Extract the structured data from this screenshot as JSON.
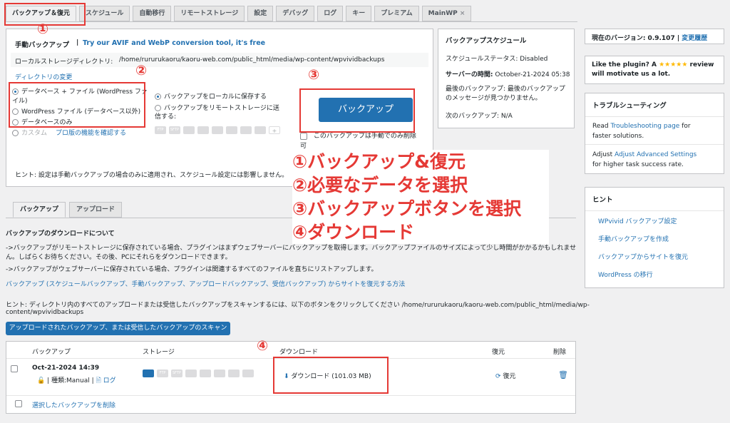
{
  "tabs": [
    "バックアップ＆復元",
    "スケジュール",
    "自動移行",
    "リモートストレージ",
    "設定",
    "デバッグ",
    "ログ",
    "キー",
    "プレミアム",
    "MainWP"
  ],
  "tab_close": "×",
  "manual": {
    "title": "手動バックアップ",
    "avif_link": "Try our AVIF and WebP conversion tool, it's free",
    "local_dir_label": "ローカルストレージディレクトリ:",
    "local_dir_value": "/home/rururukaoru/kaoru-web.com/public_html/media/wp-content/wpvividbackups",
    "change_dir": "ディレクトリの変更",
    "content_options": [
      "データベース + ファイル (WordPress ファイル)",
      "WordPress ファイル (データベース以外)",
      "データベースのみ"
    ],
    "custom_label": "カスタム",
    "pro_link": "プロ版の機能を確認する",
    "dest_options": [
      "バックアップをローカルに保存する",
      "バックアップをリモートストレージに送信する:"
    ],
    "backup_button": "バックアップ",
    "manual_delete_only": "このバックアップは手動でのみ削除可",
    "hint": "ヒント: 設定は手動バックアップの場合のみに適用され、スケジュール設定には影響しません。"
  },
  "schedule": {
    "title": "バックアップスケジュール",
    "status_label": "スケジュールステータス:",
    "status_value": "Disabled",
    "server_time_label": "サーバーの時間:",
    "server_time_value": "October-21-2024 05:38",
    "last_backup_label": "最後のバックアップ:",
    "last_backup_value": "最後のバックアップのメッセージが見つかりません。",
    "next_backup_label": "次のバックアップ:",
    "next_backup_value": "N/A"
  },
  "version": {
    "label": "現在のバージョン: 0.9.107",
    "sep": "|",
    "changelog": "変更履歴"
  },
  "like": {
    "text1": "Like the plugin? A",
    "stars": "★★★★★",
    "text2": "review",
    "text3": "will motivate us a lot."
  },
  "troubleshooting": {
    "title": "トラブルシューティング",
    "item1_pre": "Read",
    "item1_link": "Troubleshooting page",
    "item1_post": "for",
    "item1_line2": "faster solutions.",
    "item2_pre": "Adjust",
    "item2_link": "Adjust Advanced Settings",
    "item2_line2": "for higher task success rate."
  },
  "hints": {
    "title": "ヒント",
    "links": [
      "WPvivid バックアップ設定",
      "手動バックアップを作成",
      "バックアップからサイトを復元",
      "WordPress の移行"
    ]
  },
  "subtabs": [
    "バックアップ",
    "アップロード"
  ],
  "download_info": {
    "title": "バックアップのダウンロードについて",
    "line1": "->バックアップがリモートストレージに保存されている場合、プラグインはまずウェブサーバーにバックアップを取得します。バックアップファイルのサイズによって少し時間がかかるかもしれませ",
    "line1b": "ん。しばらくお待ちください。その後、PCにそれらをダウンロードできます。",
    "line2": "->バックアップがウェブサーバーに保存されている場合、プラグインは関連するすべてのファイルを直ちにリストアップします。",
    "restore_link": "バックアップ (スケジュールバックアップ、手動バックアップ、アップロードバックアップ、受信バックアップ) からサイトを復元する方法",
    "scan_hint1": "ヒント: ディレクトリ内のすべてのアップロードまたは受信したバックアップをスキャンするには、以下のボタンをクリックしてください /home/rururukaoru/kaoru-web.com/public_html/media/wp-",
    "scan_hint2": "content/wpvividbackups",
    "scan_button": "アップロードされたバックアップ、または受信したバックアップのスキャン"
  },
  "table": {
    "headers": [
      "バックアップ",
      "ストレージ",
      "ダウンロード",
      "復元",
      "削除"
    ],
    "row": {
      "date": "Oct-21-2024 14:39",
      "type": "| 種類:Manual |",
      "log": "ログ",
      "download": "ダウンロード (101.03 MB)",
      "restore": "復元"
    },
    "delete_selected": "選択したバックアップを削除"
  },
  "markers": [
    "①",
    "②",
    "③",
    "④"
  ],
  "overlay_lines": [
    "①バックアップ&復元",
    "②必要なデータを選択",
    "③バックアップボタンを選択",
    "④ダウンロード"
  ],
  "colors": {
    "accent": "#2271b1",
    "annotation": "#e53935",
    "star": "#ffb900"
  }
}
